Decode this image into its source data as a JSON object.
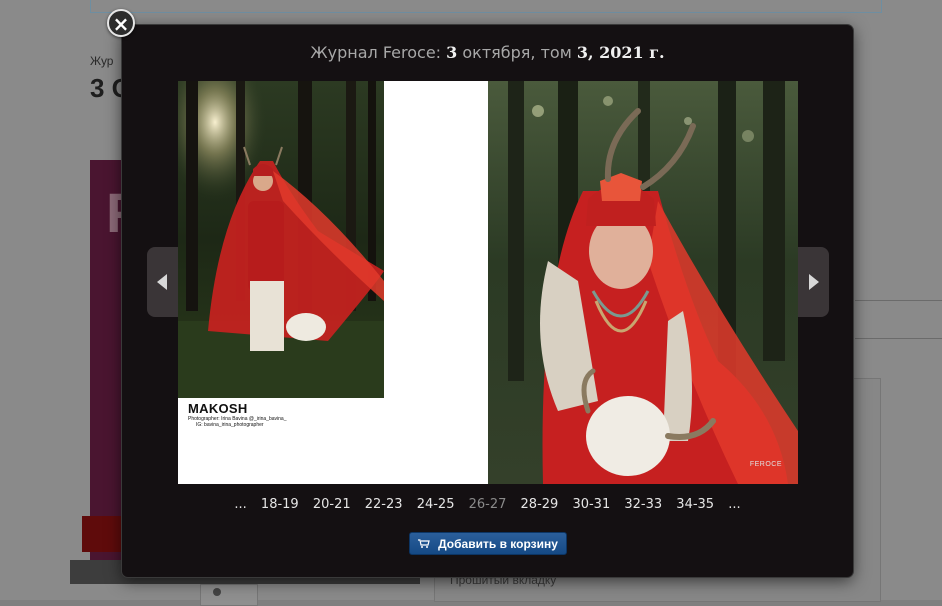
{
  "background": {
    "heading_small": "Жур",
    "heading_big": "3 О",
    "cover_letter": "F",
    "bottom_text": "Прошитый вкладку"
  },
  "modal": {
    "title_prefix": "Журнал Feroce: ",
    "title_day": "3",
    "title_middle": " октября, том ",
    "title_volume_year": "3, 2021 г.",
    "close_label": "×",
    "prev_arrow": "arrow-left-icon",
    "next_arrow": "arrow-right-icon"
  },
  "left_page": {
    "caption_title": "MAKOSH",
    "caption_line1": "Photographer: Irina Bavina @_irina_bavina_",
    "caption_line2": "IG: bavina_irina_photographer"
  },
  "right_page": {
    "watermark": "FEROCE"
  },
  "pager": {
    "items": [
      "...",
      "18-19",
      "20-21",
      "22-23",
      "24-25",
      "26-27",
      "28-29",
      "30-31",
      "32-33",
      "34-35",
      "..."
    ],
    "current": "26-27"
  },
  "cart": {
    "label": "Добавить в корзину",
    "icon": "cart-icon",
    "color": "#1d5590"
  }
}
